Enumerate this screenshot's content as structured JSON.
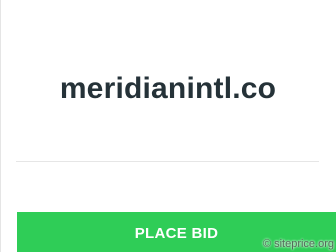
{
  "domain": {
    "name": "meridianintl.co"
  },
  "actions": {
    "place_bid_label": "PLACE BID"
  },
  "watermark": {
    "text": "© siteprice.org"
  },
  "colors": {
    "title": "#253238",
    "button_background": "#2fcd57",
    "button_text": "#ffffff",
    "divider": "#e6e6e6"
  }
}
